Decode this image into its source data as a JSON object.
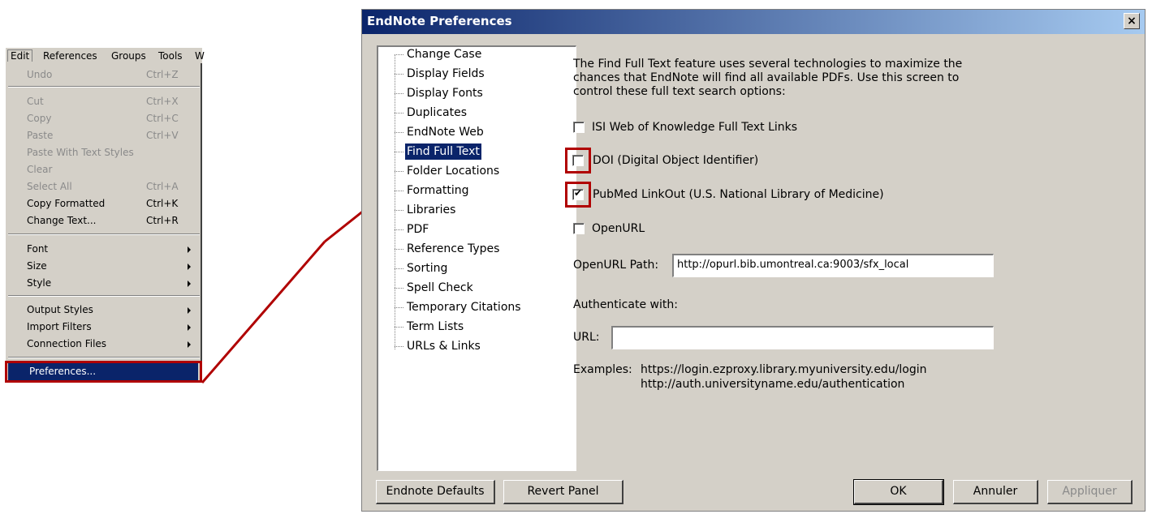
{
  "menu": {
    "menubar": [
      "Edit",
      "References",
      "Groups",
      "Tools",
      "W"
    ],
    "items": [
      {
        "label": "Undo",
        "shortcut": "Ctrl+Z",
        "disabled": true
      },
      {
        "label": "Cut",
        "shortcut": "Ctrl+X",
        "disabled": true
      },
      {
        "label": "Copy",
        "shortcut": "Ctrl+C",
        "disabled": true
      },
      {
        "label": "Paste",
        "shortcut": "Ctrl+V",
        "disabled": true
      },
      {
        "label": "Paste With Text Styles",
        "shortcut": "",
        "disabled": true
      },
      {
        "label": "Clear",
        "shortcut": "",
        "disabled": true
      },
      {
        "label": "Select All",
        "shortcut": "Ctrl+A",
        "disabled": true
      },
      {
        "label": "Copy Formatted",
        "shortcut": "Ctrl+K",
        "disabled": false
      },
      {
        "label": "Change Text...",
        "shortcut": "Ctrl+R",
        "disabled": false
      },
      {
        "label": "Font",
        "submenu": true
      },
      {
        "label": "Size",
        "submenu": true
      },
      {
        "label": "Style",
        "submenu": true
      },
      {
        "label": "Output Styles",
        "submenu": true
      },
      {
        "label": "Import Filters",
        "submenu": true
      },
      {
        "label": "Connection Files",
        "submenu": true
      },
      {
        "label": "Preferences...",
        "selected": true
      }
    ]
  },
  "dialog": {
    "title": "EndNote Preferences",
    "close_glyph": "×",
    "tree": [
      "Change Case",
      "Display Fields",
      "Display Fonts",
      "Duplicates",
      "EndNote Web",
      "Find Full Text",
      "Folder Locations",
      "Formatting",
      "Libraries",
      "PDF",
      "Reference Types",
      "Sorting",
      "Spell Check",
      "Temporary Citations",
      "Term Lists",
      "URLs & Links"
    ],
    "selected_tree_item": "Find Full Text",
    "description": [
      "The Find Full Text feature uses several technologies to maximize the",
      "chances that EndNote will find all available PDFs. Use this screen to",
      "control these full text search options:"
    ],
    "options": [
      {
        "label": "ISI Web of Knowledge Full Text Links",
        "checked": false
      },
      {
        "label": "DOI (Digital Object Identifier)",
        "checked": false
      },
      {
        "label": "PubMed LinkOut (U.S. National Library of Medicine)",
        "checked": true
      },
      {
        "label": "OpenURL",
        "checked": false
      }
    ],
    "check_glyph": "✔",
    "openurl_label": "OpenURL Path:",
    "openurl_value": "http://opurl.bib.umontreal.ca:9003/sfx_local",
    "authenticate_label": "Authenticate with:",
    "url_label": "URL:",
    "url_value": "",
    "examples_label": "Examples:",
    "examples": [
      "https://login.ezproxy.library.myuniversity.edu/login",
      "http://auth.universityname.edu/authentication"
    ],
    "buttons": {
      "defaults": "Endnote Defaults",
      "revert": "Revert Panel",
      "ok": "OK",
      "cancel": "Annuler",
      "apply": "Appliquer"
    }
  },
  "colors": {
    "highlight": "#0a246a",
    "annotation_red": "#b00000",
    "face": "#d4d0c8"
  }
}
